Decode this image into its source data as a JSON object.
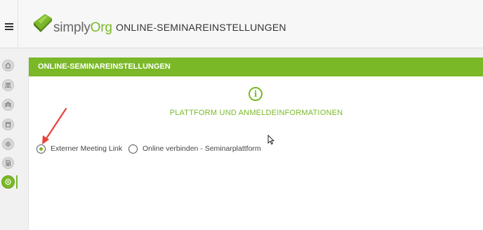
{
  "brand": {
    "name_part1": "simply",
    "name_part2": "Org",
    "green": "#7ab828"
  },
  "header": {
    "title": "ONLINE-SEMINAREINSTELLUNGEN",
    "menu_icon": "hamburger-icon"
  },
  "sidebar": {
    "items": [
      {
        "icon": "home-icon"
      },
      {
        "icon": "users-icon"
      },
      {
        "icon": "building-icon"
      },
      {
        "icon": "calendar-icon"
      },
      {
        "icon": "sun-icon"
      },
      {
        "icon": "document-icon"
      },
      {
        "icon": "settings-icon",
        "active": true
      }
    ]
  },
  "panel": {
    "header": "ONLINE-SEMINAREINSTELLUNGEN",
    "section_title": "PLATTFORM UND ANMELDEINFORMATIONEN",
    "info_glyph": "i",
    "options": [
      {
        "label": "Externer Meeting Link",
        "selected": true
      },
      {
        "label": "Online verbinden - Seminarplattform",
        "selected": false
      }
    ]
  }
}
